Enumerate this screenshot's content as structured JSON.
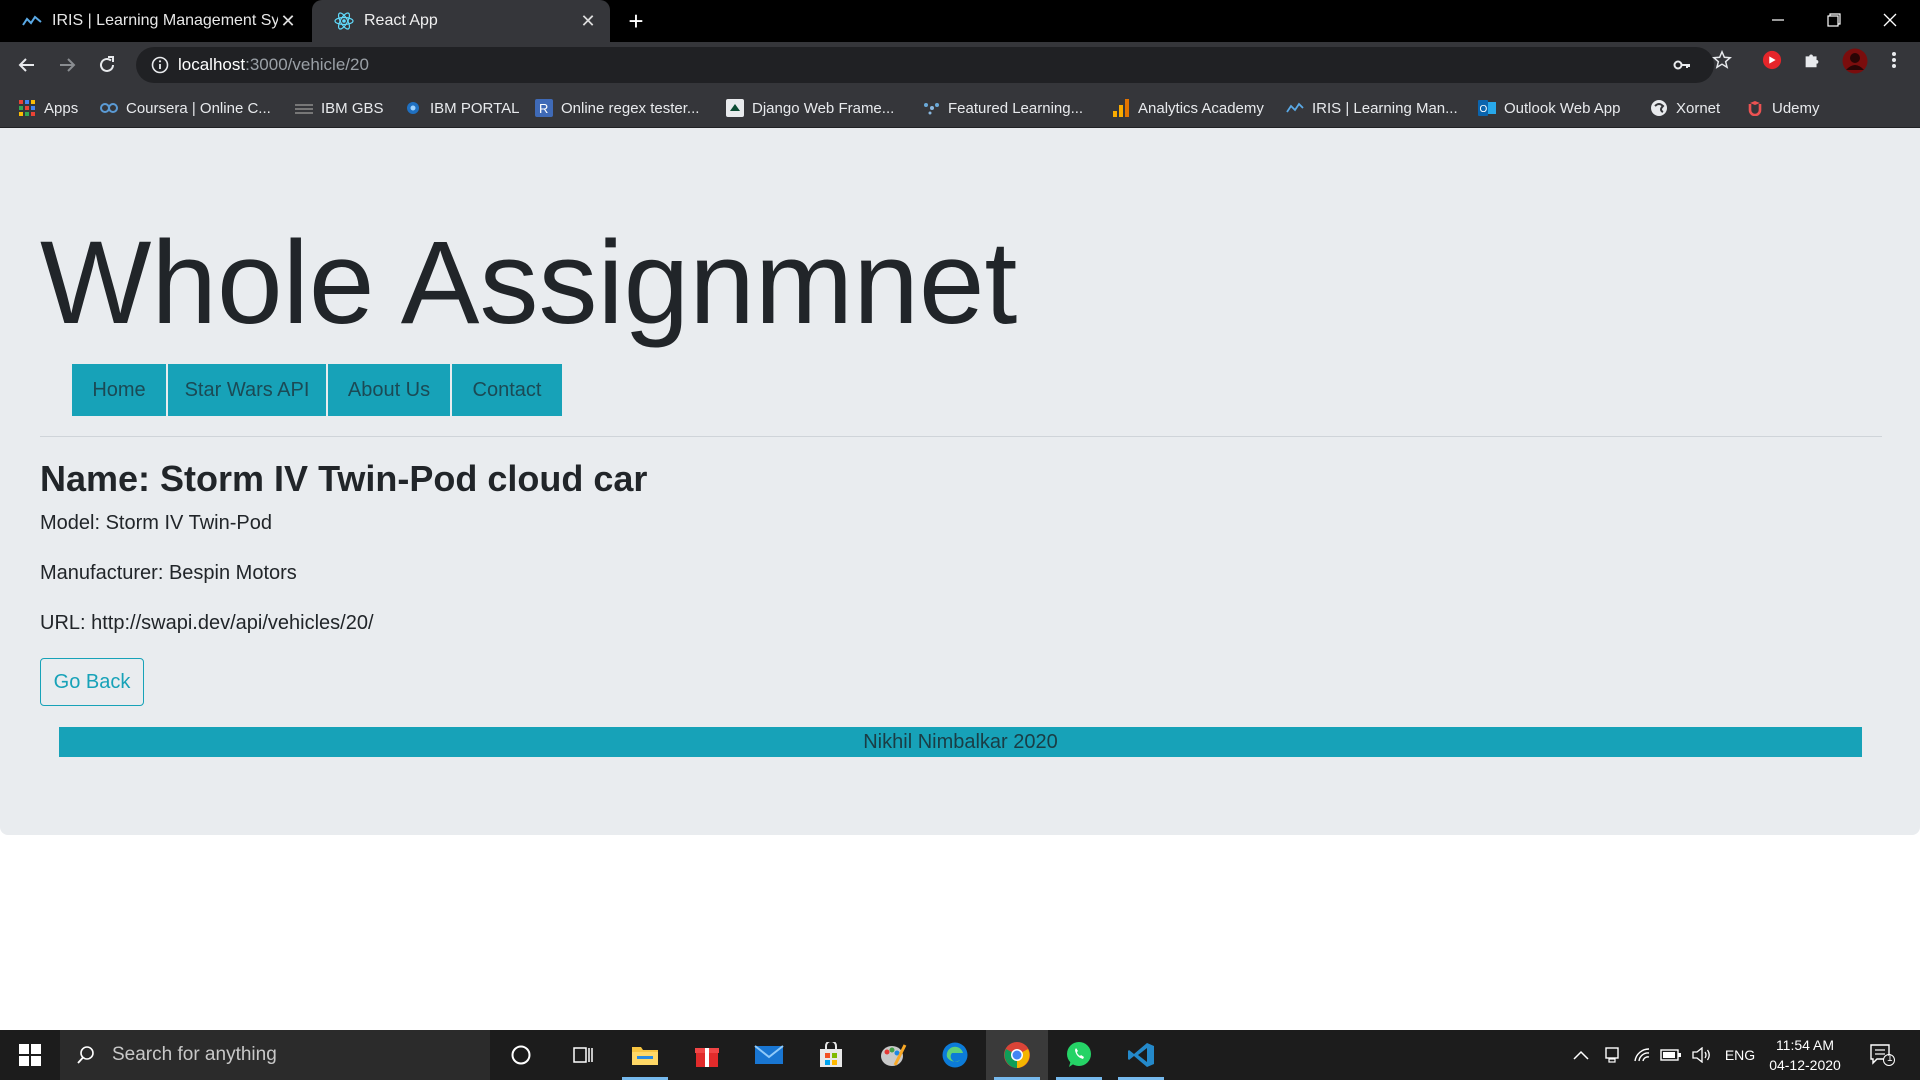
{
  "browser": {
    "tabs": [
      {
        "title": "IRIS | Learning Management System",
        "icon": "iris-logo-icon",
        "active": false
      },
      {
        "title": "React App",
        "icon": "react-logo-icon",
        "active": true
      }
    ],
    "address": {
      "host": "localhost",
      "path": ":3000/vehicle/20"
    },
    "bookmarks": [
      {
        "label": "Apps",
        "icon": "apps-grid-icon"
      },
      {
        "label": "Coursera | Online C...",
        "icon": "coursera-icon"
      },
      {
        "label": "IBM GBS",
        "icon": "ibm-gbs-icon"
      },
      {
        "label": "IBM PORTAL",
        "icon": "ibm-portal-icon"
      },
      {
        "label": "Online regex tester...",
        "icon": "regex-icon"
      },
      {
        "label": "Django Web Frame...",
        "icon": "django-icon"
      },
      {
        "label": "Featured Learning...",
        "icon": "featured-learning-icon"
      },
      {
        "label": "Analytics Academy",
        "icon": "analytics-icon"
      },
      {
        "label": "IRIS | Learning Man...",
        "icon": "iris-logo-icon"
      },
      {
        "label": "Outlook Web App",
        "icon": "outlook-icon"
      },
      {
        "label": "Xornet",
        "icon": "xornet-icon"
      },
      {
        "label": "Udemy",
        "icon": "udemy-icon"
      }
    ]
  },
  "page": {
    "heading": "Whole Assignmnet",
    "nav": [
      "Home",
      "Star Wars API",
      "About Us",
      "Contact"
    ],
    "vehicle": {
      "name_line": "Name: Storm IV Twin-Pod cloud car",
      "model_line": "Model: Storm IV Twin-Pod",
      "manufacturer_line": "Manufacturer: Bespin Motors",
      "url_line": "URL: http://swapi.dev/api/vehicles/20/"
    },
    "go_back_label": "Go Back",
    "footer": "Nikhil Nimbalkar 2020"
  },
  "taskbar": {
    "search_placeholder": "Search for anything",
    "language": "ENG",
    "time": "11:54 AM",
    "date": "04-12-2020",
    "notification_count": "1"
  },
  "colors": {
    "accent": "#17a2b8",
    "page_bg": "#e9ecef",
    "chrome_dark": "#35363a"
  }
}
